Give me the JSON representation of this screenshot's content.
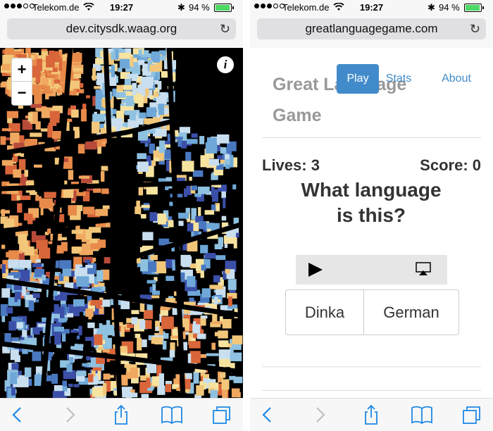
{
  "status_bar": {
    "carrier": "Telekom.de",
    "time": "19:27",
    "battery_percent": "94 %",
    "battery_level": 0.94,
    "signal_bars": 3
  },
  "left_screen": {
    "url": "dev.citysdk.waag.org",
    "map": {
      "zoom_in_label": "+",
      "zoom_out_label": "−",
      "info_label": "i"
    }
  },
  "right_screen": {
    "url": "greatlanguagegame.com",
    "brand": "Great Language Game",
    "nav": {
      "play": "Play",
      "stats": "Stats",
      "about": "About"
    },
    "game": {
      "lives": "Lives: 3",
      "score": "Score: 0",
      "question": "What language is this?",
      "answers": [
        "Dinka",
        "German"
      ]
    }
  },
  "toolbar_icons": [
    "back-icon",
    "forward-icon",
    "share-icon",
    "bookmarks-icon",
    "tabs-icon"
  ],
  "colors": {
    "accent": "#428bca",
    "ios_blue": "#1e88e5",
    "battery_green": "#4cd964"
  }
}
